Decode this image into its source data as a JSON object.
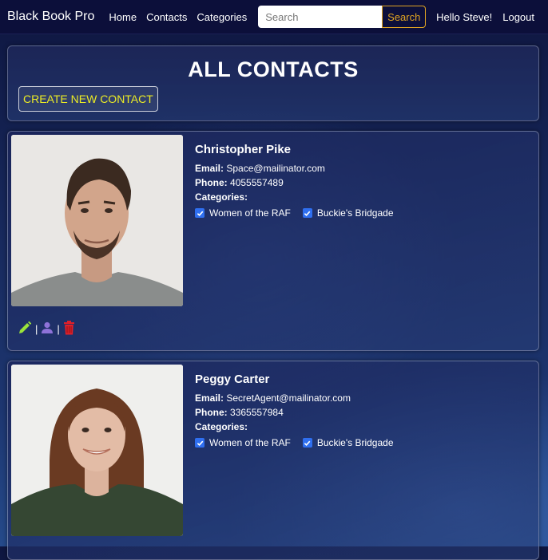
{
  "navbar": {
    "brand": "Black Book Pro",
    "links": [
      "Home",
      "Contacts",
      "Categories"
    ],
    "search": {
      "placeholder": "Search",
      "value": "",
      "button": "Search"
    },
    "greeting": "Hello Steve!",
    "logout": "Logout"
  },
  "header": {
    "title": "ALL CONTACTS",
    "create_button": "CREATE NEW CONTACT"
  },
  "contacts": [
    {
      "name": "Christopher Pike",
      "email_label": "Email:",
      "email": "Space@mailinator.com",
      "phone_label": "Phone:",
      "phone": "4055557489",
      "categories_label": "Categories:",
      "categories": [
        "Women of the RAF",
        "Buckie's Bridgade"
      ]
    },
    {
      "name": "Peggy Carter",
      "email_label": "Email:",
      "email": "SecretAgent@mailinator.com",
      "phone_label": "Phone:",
      "phone": "3365557984",
      "categories_label": "Categories:",
      "categories": [
        "Women of the RAF",
        "Buckie's Bridgade"
      ]
    }
  ],
  "actions": {
    "separator": "|",
    "edit_icon": "pencil-icon",
    "details_icon": "person-icon",
    "delete_icon": "trash-icon",
    "edit_color": "#9be43a",
    "details_color": "#8e72d8",
    "delete_color": "#e0202a"
  },
  "colors": {
    "navbar_bg": "#0c0f3a",
    "search_accent": "#e0a422",
    "create_text": "#ecec24",
    "checkbox": "#2f6ff0"
  }
}
